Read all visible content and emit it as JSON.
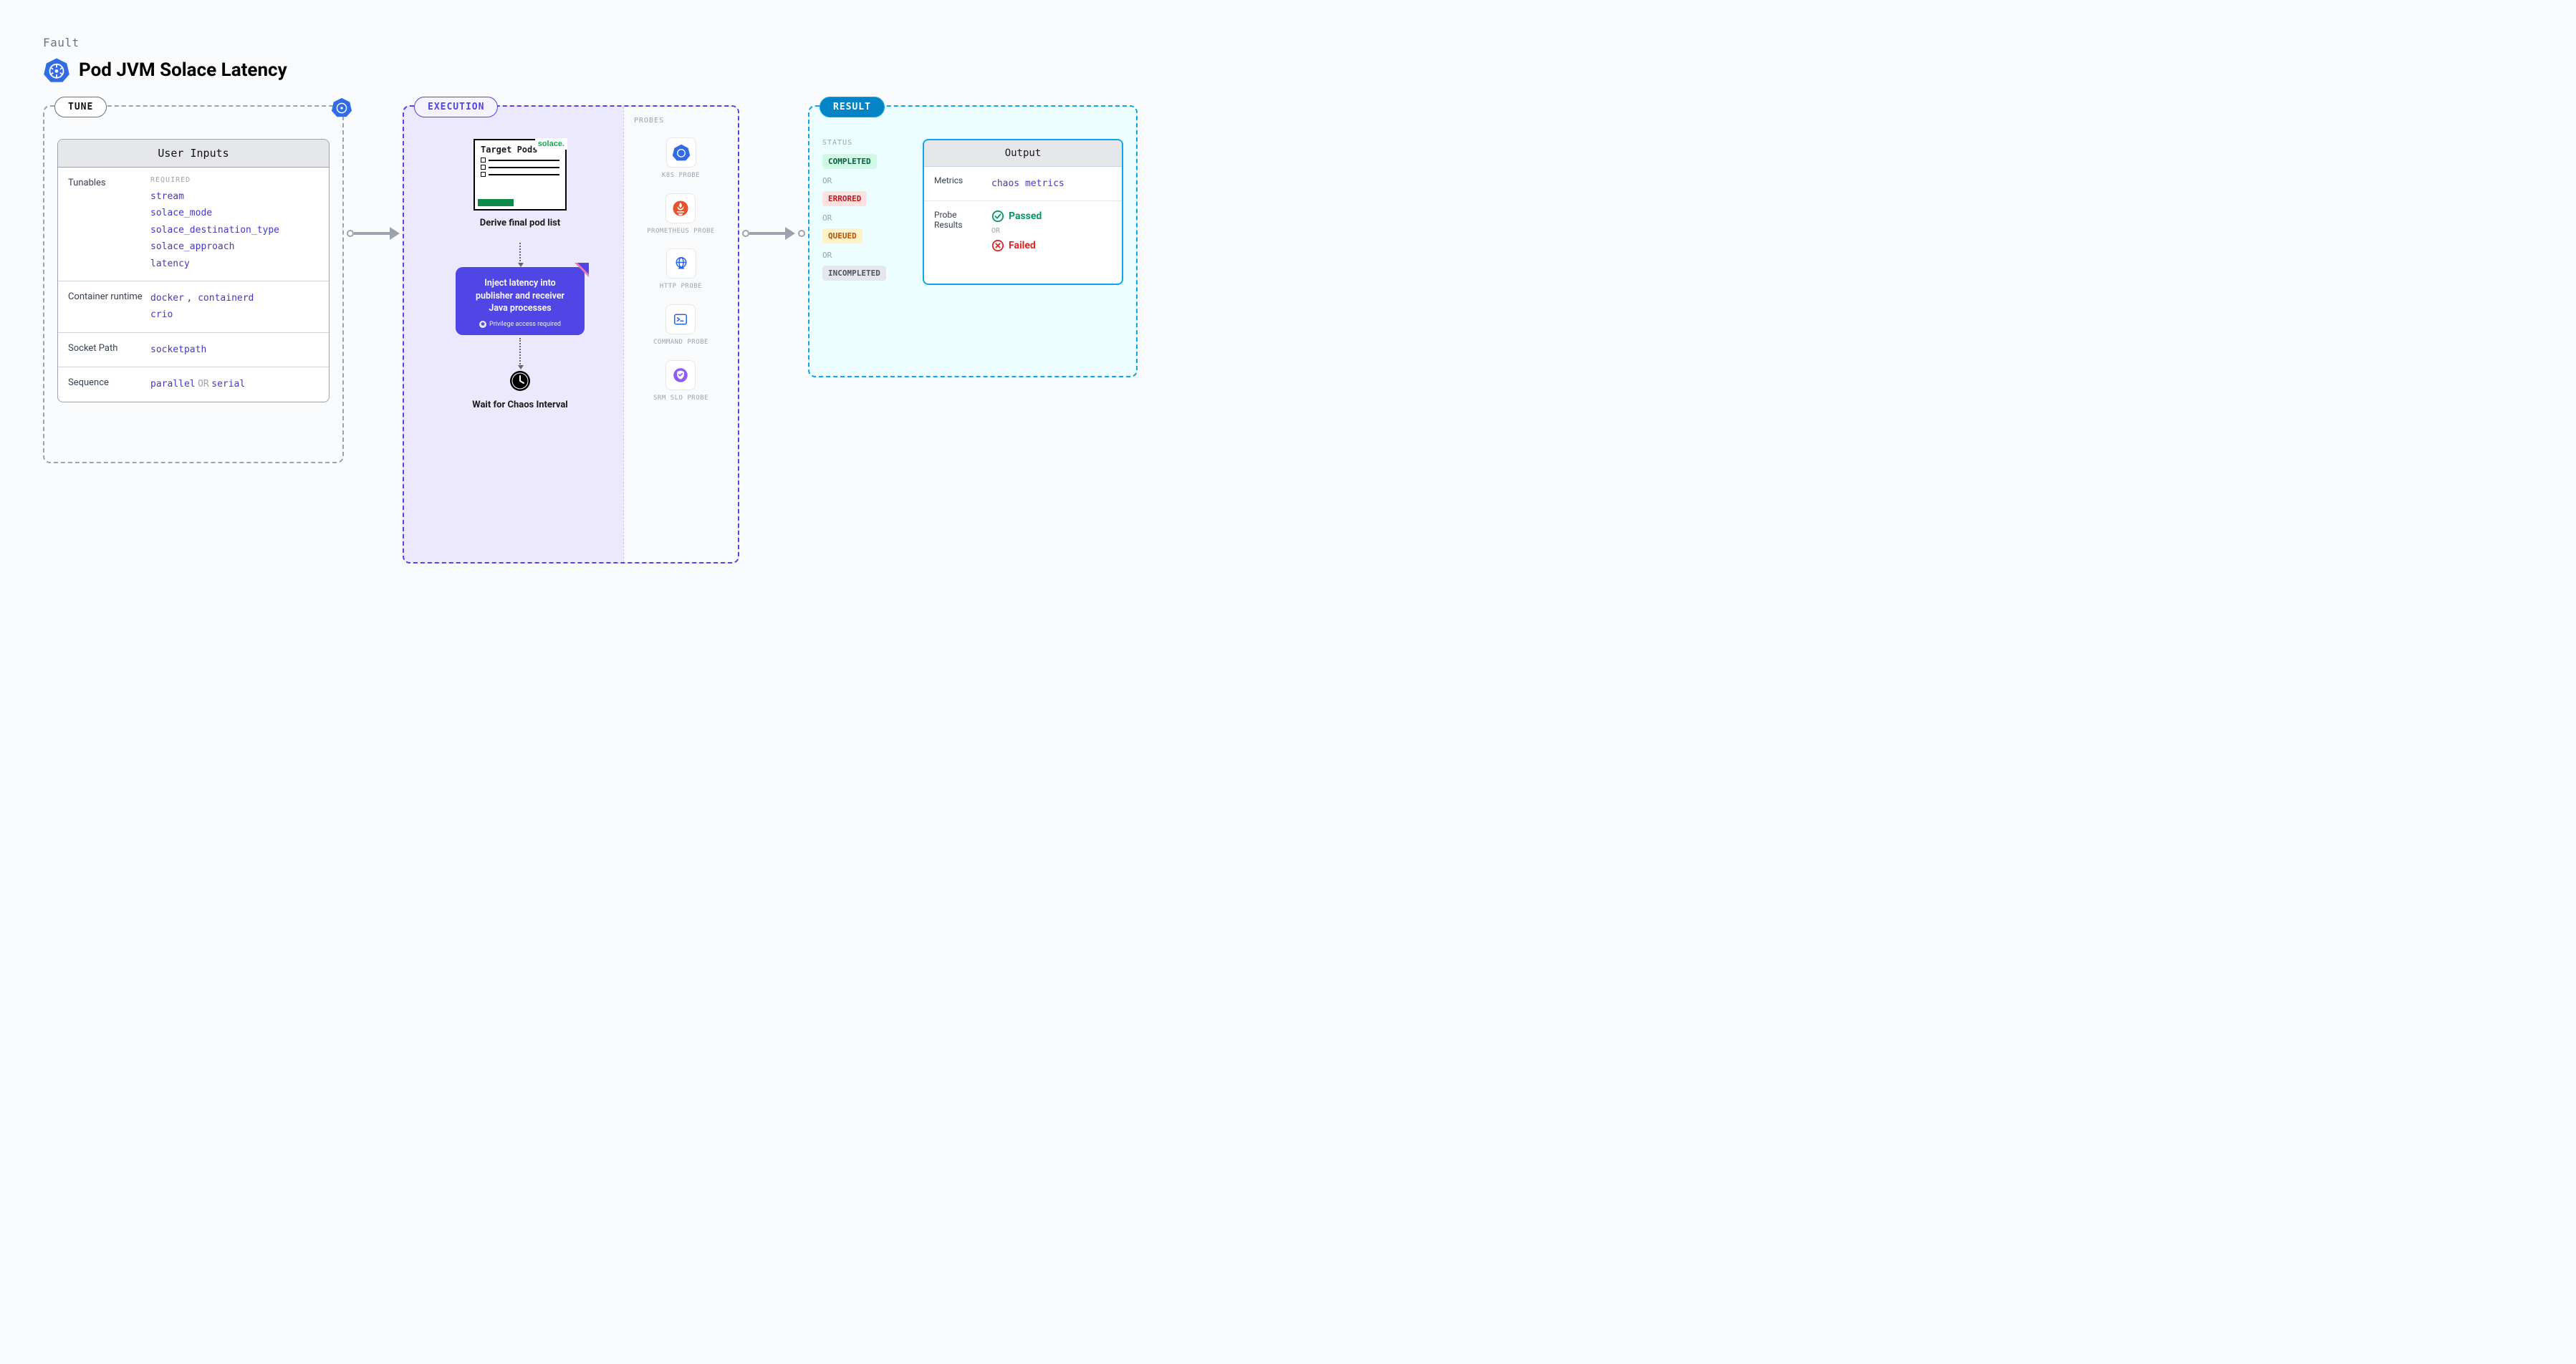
{
  "header": {
    "kicker": "Fault",
    "title": "Pod JVM Solace Latency"
  },
  "tune": {
    "label": "TUNE",
    "card_title": "User Inputs",
    "rows": {
      "tunables": {
        "label": "Tunables",
        "required_label": "REQUIRED",
        "values": [
          "stream",
          "solace_mode",
          "solace_destination_type",
          "solace_approach",
          "latency"
        ]
      },
      "container_runtime": {
        "label": "Container runtime",
        "values_text": "docker , containerd crio",
        "v1": "docker",
        "sep": " , ",
        "v2": "containerd",
        "v3": "crio"
      },
      "socket_path": {
        "label": "Socket Path",
        "value": "socketpath"
      },
      "sequence": {
        "label": "Sequence",
        "v1": "parallel",
        "kw": "OR",
        "v2": "serial"
      }
    }
  },
  "execution": {
    "label": "EXECUTION",
    "solace_tag": "solace.",
    "target_pods_title": "Target Pods",
    "step1": "Derive final pod list",
    "inject_text": "Inject latency into publisher and receiver Java processes",
    "priv_text": "Privilege access required",
    "step3": "Wait for Chaos Interval",
    "probes": {
      "title": "PROBES",
      "items": [
        {
          "label": "K8S PROBE",
          "icon": "k8s"
        },
        {
          "label": "PROMETHEUS PROBE",
          "icon": "prometheus"
        },
        {
          "label": "HTTP PROBE",
          "icon": "http"
        },
        {
          "label": "COMMAND PROBE",
          "icon": "command"
        },
        {
          "label": "SRM SLO PROBE",
          "icon": "srm"
        }
      ]
    }
  },
  "result": {
    "label": "RESULT",
    "status_title": "STATUS",
    "or": "OR",
    "badges": {
      "completed": "COMPLETED",
      "errored": "ERRORED",
      "queued": "QUEUED",
      "incompleted": "INCOMPLETED"
    },
    "output": {
      "title": "Output",
      "metrics_label": "Metrics",
      "metrics_value": "chaos metrics",
      "probe_label": "Probe Results",
      "passed": "Passed",
      "failed": "Failed",
      "or": "OR"
    }
  }
}
